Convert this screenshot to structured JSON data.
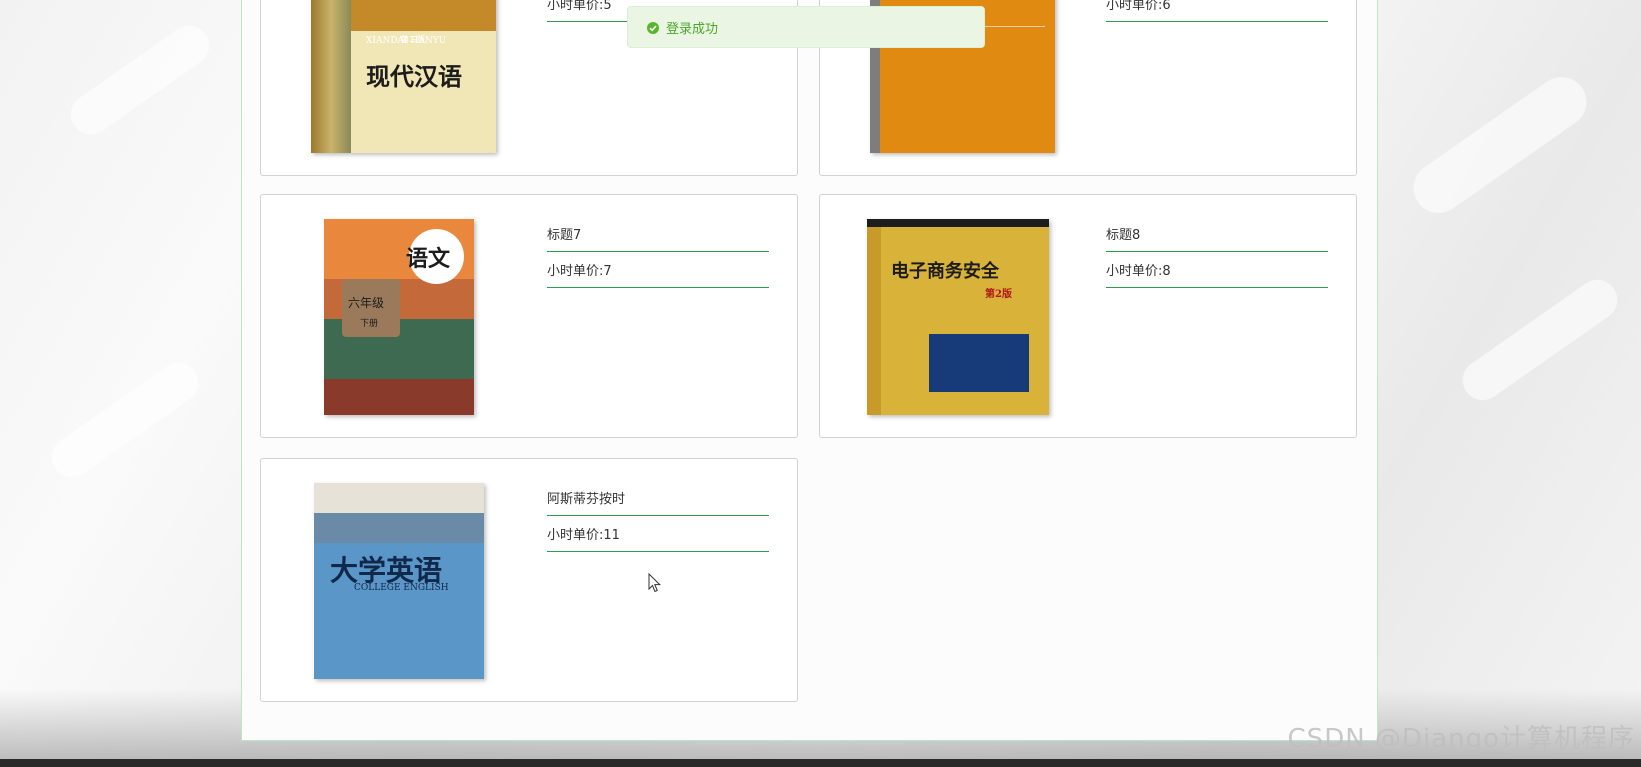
{
  "toast": {
    "message": "登录成功"
  },
  "cards": [
    {
      "title": "",
      "price": "小时单价:5",
      "cover_text": "现代汉语",
      "cover_en": "XIANDAI HANYU",
      "cover_edition": "第二版"
    },
    {
      "title": "",
      "price": "小时单价:6",
      "cover_text": ""
    },
    {
      "title": "标题7",
      "price": "小时单价:7",
      "cover_text": "语文",
      "cover_sub": "六年级",
      "cover_sub2": "下册"
    },
    {
      "title": "标题8",
      "price": "小时单价:8",
      "cover_text": "电子商务安全",
      "cover_edition": "第2版"
    },
    {
      "title": "阿斯蒂芬按时",
      "price": "小时单价:11",
      "cover_text": "大学英语",
      "cover_en": "COLLEGE ENGLISH"
    }
  ],
  "watermark": "CSDN @Django计算机程序",
  "colors": {
    "accent": "#2e9a52",
    "toast_bg": "#eaf5e3",
    "toast_text": "#4ba72a"
  }
}
